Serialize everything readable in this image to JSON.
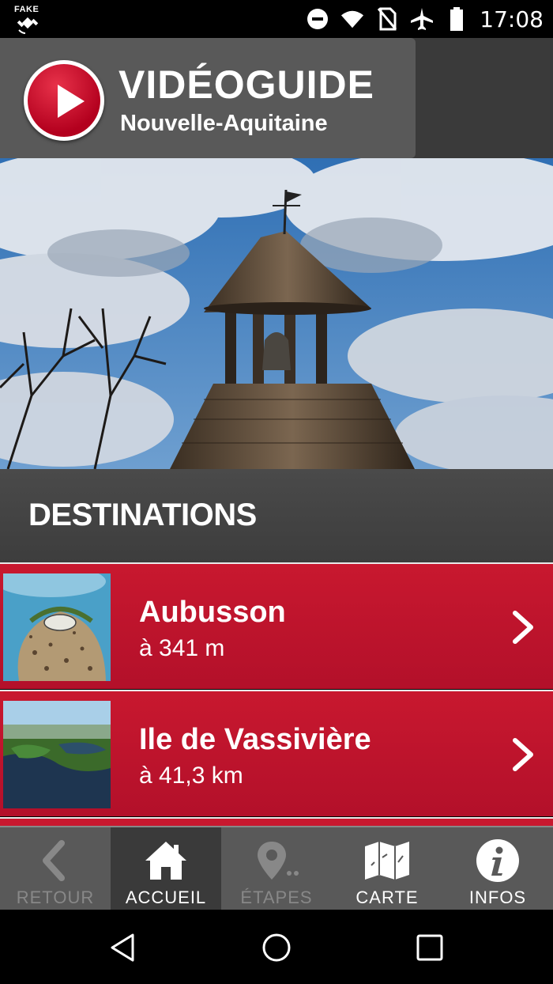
{
  "status_bar": {
    "fake_label": "FAKE",
    "time": "17:08"
  },
  "header": {
    "title": "VIDÉOGUIDE",
    "subtitle": "Nouvelle-Aquitaine"
  },
  "section": {
    "title": "DESTINATIONS"
  },
  "destinations": [
    {
      "name": "Aubusson",
      "distance": "à 341 m"
    },
    {
      "name": "Ile de Vassivière",
      "distance": "à 41,3 km"
    }
  ],
  "tabs": [
    {
      "label": "RETOUR",
      "icon": "back-chevron-icon",
      "state": "disabled"
    },
    {
      "label": "ACCUEIL",
      "icon": "home-icon",
      "state": "active"
    },
    {
      "label": "ÉTAPES",
      "icon": "location-pin-icon",
      "state": "disabled"
    },
    {
      "label": "CARTE",
      "icon": "map-icon",
      "state": "normal"
    },
    {
      "label": "INFOS",
      "icon": "info-icon",
      "state": "normal"
    }
  ],
  "colors": {
    "accent_red": "#c8182f",
    "tab_bar": "#595959",
    "tab_active": "#3a3a3a"
  }
}
